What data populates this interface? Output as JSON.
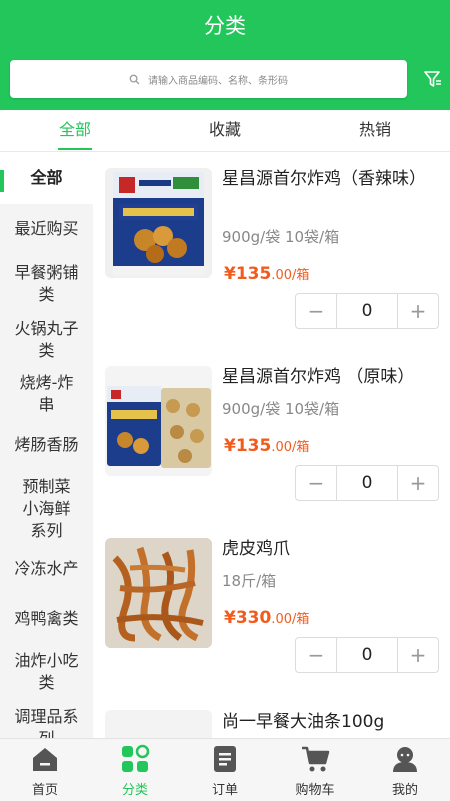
{
  "header": {
    "title": "分类",
    "search_placeholder": "请输入商品编码、名称、条形码",
    "filter_icon": "filter-icon"
  },
  "tabs": [
    {
      "label": "全部",
      "active": true
    },
    {
      "label": "收藏",
      "active": false
    },
    {
      "label": "热销",
      "active": false
    }
  ],
  "sidebar": {
    "active_index": 0,
    "items": [
      {
        "label": "全部"
      },
      {
        "label": "最近购买"
      },
      {
        "label": "早餐粥铺类"
      },
      {
        "label": "火锅丸子类"
      },
      {
        "label": "烧烤-炸串"
      },
      {
        "label": "烤肠香肠"
      },
      {
        "label": "预制菜小海鲜系列"
      },
      {
        "label": "冷冻水产"
      },
      {
        "label": "鸡鸭禽类"
      },
      {
        "label": "油炸小吃类"
      },
      {
        "label": "调理品系列"
      }
    ]
  },
  "products": [
    {
      "name": "星昌源首尔炸鸡（香辣味）",
      "spec": "900g/袋 10袋/箱",
      "currency": "¥",
      "price": "135",
      "price_decimal": ".00",
      "unit": "/箱",
      "qty": "0",
      "image": "chicken-bag-image"
    },
    {
      "name": "星昌源首尔炸鸡 （原味）",
      "spec": "900g/袋 10袋/箱",
      "currency": "¥",
      "price": "135",
      "price_decimal": ".00",
      "unit": "/箱",
      "qty": "0",
      "image": "chicken-bags-image"
    },
    {
      "name": "虎皮鸡爪",
      "spec": "18斤/箱",
      "currency": "¥",
      "price": "330",
      "price_decimal": ".00",
      "unit": "/箱",
      "qty": "0",
      "image": "chicken-feet-image"
    },
    {
      "name": "尚一早餐大油条100g",
      "image": "fried-dough-image"
    }
  ],
  "stepper": {
    "minus": "−",
    "plus": "+"
  },
  "bottom_nav": [
    {
      "label": "首页",
      "icon": "home-icon",
      "active": false
    },
    {
      "label": "分类",
      "icon": "category-icon",
      "active": true
    },
    {
      "label": "订单",
      "icon": "order-icon",
      "active": false
    },
    {
      "label": "购物车",
      "icon": "cart-icon",
      "active": false
    },
    {
      "label": "我的",
      "icon": "profile-icon",
      "active": false
    }
  ],
  "colors": {
    "brand": "#22c65b",
    "price": "#f25b1c"
  }
}
